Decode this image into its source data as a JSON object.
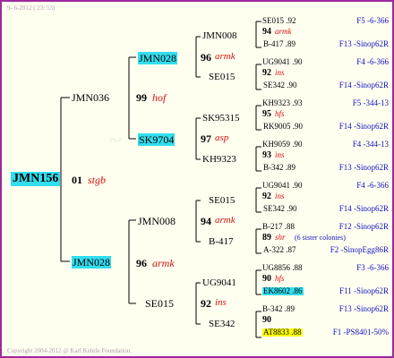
{
  "header": "9- 6-2012 ( 23: 53)",
  "footer": "Copyright 2004-2012 @ Karl Kehrle Foundation.",
  "root": {
    "name": "JMN156",
    "num": "01",
    "place": "stgb"
  },
  "gen1": [
    {
      "name": "JMN036",
      "num": "99",
      "place": "hof"
    },
    {
      "name": "JMN028",
      "num": "96",
      "place": "armk"
    }
  ],
  "gen2": [
    {
      "name": "JMN028",
      "num": "96",
      "place": "armk"
    },
    {
      "name": "SK9704",
      "num": "97",
      "place": "asp"
    },
    {
      "name": "JMN008",
      "num": "94",
      "place": "armk"
    },
    {
      "name": "SE015",
      "num": "92",
      "place": "ins"
    }
  ],
  "gen3": [
    {
      "name": "JMN008"
    },
    {
      "name": "SE015"
    },
    {
      "name": "SK95315"
    },
    {
      "name": "KH9323"
    },
    {
      "name": "SE015"
    },
    {
      "name": "B-417"
    },
    {
      "name": "UG9041"
    },
    {
      "name": "SE342"
    }
  ],
  "gen4": [
    {
      "top": "SE015 .92",
      "num": "94",
      "place": "armk",
      "bot": "B-417 .89",
      "topcode": "F5 -6-366",
      "botcode": "F13 -Sinop62R"
    },
    {
      "top": "UG9041 .90",
      "num": "92",
      "place": "ins",
      "bot": "SE342 .90",
      "topcode": "F4 -6-366",
      "botcode": "F14 -Sinop62R"
    },
    {
      "top": "KH9323 .93",
      "num": "95",
      "place": "hfs",
      "bot": "RK9005 .90",
      "topcode": "F5 -344-13",
      "botcode": "F14 -Sinop62R"
    },
    {
      "top": "KH9059 .90",
      "num": "93",
      "place": "ins",
      "bot": "B-342 .89",
      "topcode": "F4 -344-13",
      "botcode": "F13 -Sinop62R"
    },
    {
      "top": "UG9041 .90",
      "num": "92",
      "place": "ins",
      "bot": "SE342 .90",
      "topcode": "F4 -6-366",
      "botcode": "F14 -Sinop62R"
    },
    {
      "top": "B-217 .88",
      "num": "89",
      "place": "shr",
      "note": "(6 sister colonies)",
      "bot": "A-322 .87",
      "topcode": "F12 -Sinop62R",
      "botcode": "F2 -SinopEgg86R"
    },
    {
      "top": "UG8856 .88",
      "num": "90",
      "place": "hfs",
      "bot": "EK8602 .86",
      "topcode": "F3 -6-366",
      "botcode": "F11 -Sinop62R"
    },
    {
      "top": "B-342 .89",
      "num": "90",
      "place": "",
      "bot": "AT8833 .88",
      "topcode": "F13 -Sinop62R",
      "botcode": "F1 -PS8401-50%"
    }
  ]
}
